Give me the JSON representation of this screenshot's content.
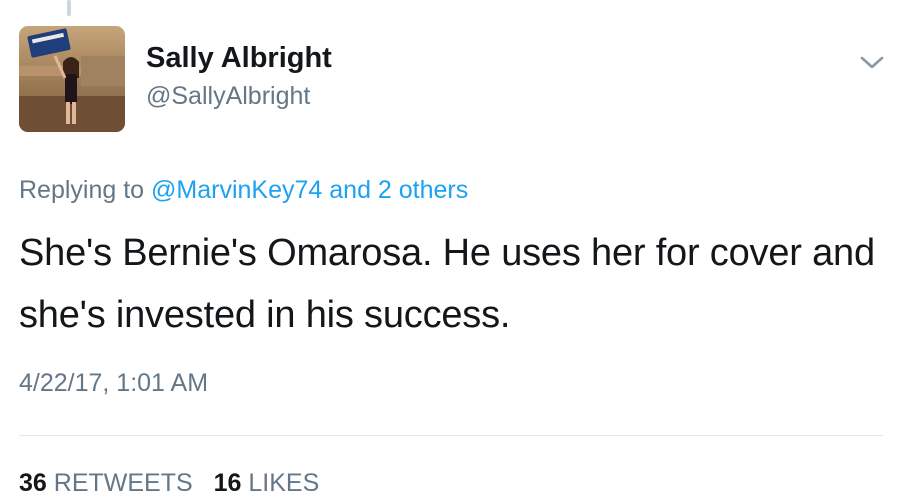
{
  "tweet": {
    "author": {
      "display_name": "Sally Albright",
      "handle": "@SallyAlbright",
      "avatar_icon": "profile-photo"
    },
    "reply": {
      "prefix": "Replying to",
      "mention": "@MarvinKey74",
      "others": "and 2 others"
    },
    "text": "She's Bernie's Omarosa. He uses her for cover and she's invested in his success.",
    "timestamp": "4/22/17, 1:01 AM",
    "stats": {
      "retweets_count": "36",
      "retweets_label": "RETWEETS",
      "likes_count": "16",
      "likes_label": "LIKES"
    },
    "menu_icon": "chevron-down-icon"
  },
  "colors": {
    "text_primary": "#14171a",
    "text_secondary": "#657786",
    "link": "#1da1f2",
    "divider": "#e1e8ed"
  }
}
